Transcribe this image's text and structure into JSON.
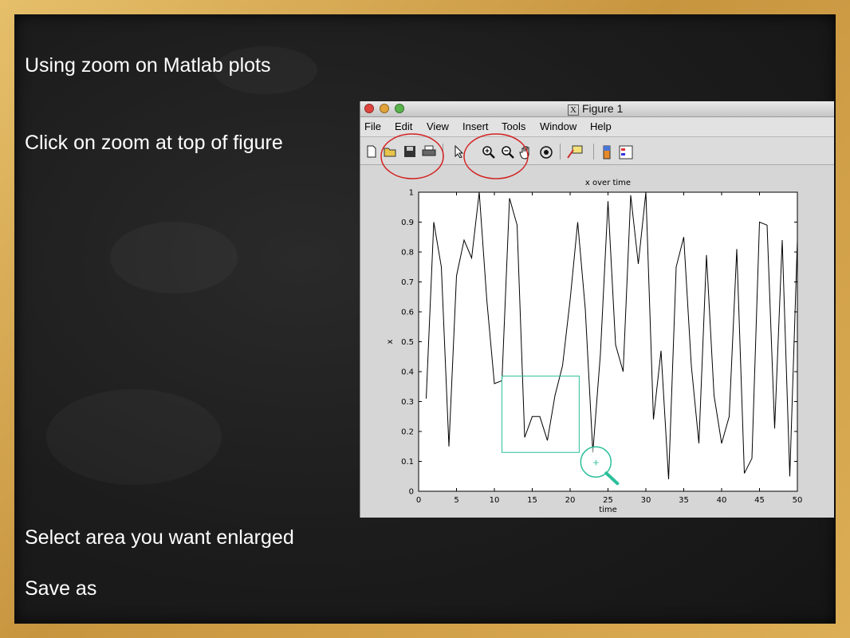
{
  "slide": {
    "heading": "Using zoom on Matlab plots",
    "step1": "Click on zoom at top of figure",
    "step2": "Select area you want enlarged",
    "step3": "Save as"
  },
  "window": {
    "title": "Figure 1",
    "x_badge": "X",
    "traffic_colors": [
      "#e0443e",
      "#e2a33a",
      "#58b34a"
    ]
  },
  "menu": {
    "items": [
      "File",
      "Edit",
      "View",
      "Insert",
      "Tools",
      "Window",
      "Help"
    ]
  },
  "toolbar": {
    "icons": [
      "new-figure-icon",
      "open-file-icon",
      "save-icon",
      "print-icon",
      "pointer-icon",
      "zoom-in-icon",
      "zoom-out-icon",
      "pan-hand-icon",
      "rotate-3d-icon",
      "data-cursor-icon",
      "colorbar-icon",
      "legend-icon"
    ],
    "highlight_color": "#d42020"
  },
  "zoom_selection_color": "#2bbf9a",
  "chart_data": {
    "type": "line",
    "title": "x over time",
    "xlabel": "time",
    "ylabel": "x",
    "xlim": [
      0,
      50
    ],
    "ylim": [
      0,
      1
    ],
    "xticks": [
      0,
      5,
      10,
      15,
      20,
      25,
      30,
      35,
      40,
      45,
      50
    ],
    "yticks": [
      0,
      0.1,
      0.2,
      0.3,
      0.4,
      0.5,
      0.6,
      0.7,
      0.8,
      0.9,
      1
    ],
    "grid": false,
    "series": [
      {
        "x": [
          1,
          2,
          3,
          4,
          5,
          6,
          7,
          8,
          9,
          10,
          11,
          12,
          13,
          14,
          15,
          16,
          17,
          18,
          19,
          20,
          21,
          22,
          23,
          24,
          25,
          26,
          27,
          28,
          29,
          30,
          31,
          32,
          33,
          34,
          35,
          36,
          37,
          38,
          39,
          40,
          41,
          42,
          43,
          44,
          45,
          46,
          47,
          48,
          49,
          50
        ],
        "values": [
          0.31,
          0.9,
          0.75,
          0.15,
          0.72,
          0.84,
          0.78,
          1.0,
          0.64,
          0.36,
          0.37,
          0.98,
          0.89,
          0.18,
          0.25,
          0.25,
          0.17,
          0.32,
          0.42,
          0.64,
          0.9,
          0.61,
          0.13,
          0.46,
          0.97,
          0.49,
          0.4,
          0.99,
          0.76,
          1.0,
          0.24,
          0.47,
          0.04,
          0.75,
          0.85,
          0.42,
          0.16,
          0.79,
          0.32,
          0.16,
          0.25,
          0.81,
          0.06,
          0.11,
          0.9,
          0.89,
          0.21,
          0.84,
          0.05,
          0.84
        ],
        "color": "#000000"
      }
    ],
    "zoom_box": {
      "x": [
        11,
        21.2
      ],
      "y": [
        0.13,
        0.385
      ]
    }
  }
}
